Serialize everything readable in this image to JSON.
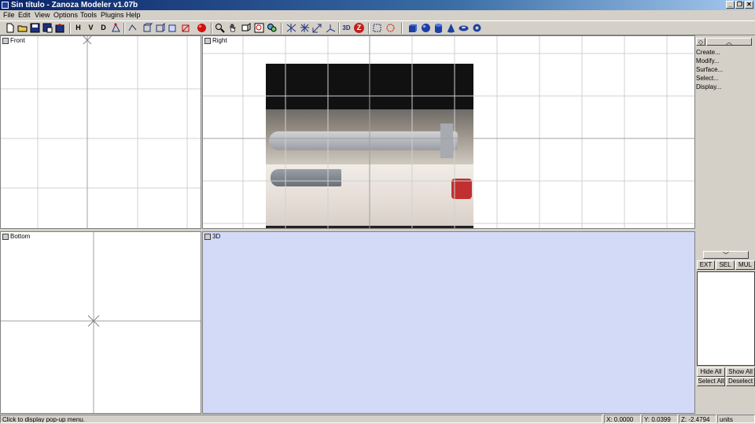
{
  "window": {
    "title": "Sin título - Zanoza Modeler v1.07b"
  },
  "window_buttons": {
    "minimize": "_",
    "restore": "❐",
    "close": "✕"
  },
  "menu": [
    "File",
    "Edit",
    "View",
    "Options",
    "Tools",
    "Plugins",
    "Help"
  ],
  "toolbar": {
    "group1": [
      "new-file-icon",
      "open-folder-icon",
      "save-icon",
      "save-as-icon",
      "export-icon"
    ],
    "view_buttons": [
      "H",
      "V",
      "D"
    ],
    "group2": [
      "select-vertex-icon",
      "select-edge-icon",
      "select-face-icon",
      "select-object-icon",
      "select-group-icon",
      "select-all-icon",
      "material-icon",
      "render-sphere-icon"
    ],
    "group3": [
      "zoom-icon",
      "pan-hand-icon",
      "rotate-view-icon",
      "zoom-extents-icon",
      "zoom-all-icon"
    ],
    "group4": [
      "move-icon",
      "rotate-icon",
      "scale-icon",
      "axis-icon"
    ],
    "group5_text": [
      "3D",
      "Z"
    ],
    "group6": [
      "rect-select-icon",
      "circle-select-icon"
    ],
    "primitives": [
      "box-primitive-icon",
      "sphere-primitive-icon",
      "cylinder-primitive-icon",
      "cone-primitive-icon",
      "torus-primitive-icon",
      "tube-primitive-icon"
    ],
    "colors": {
      "accent_blue": "#1c3fa3",
      "sphere_red": "#d41010"
    }
  },
  "viewports": {
    "front": {
      "label": "Front"
    },
    "right": {
      "label": "Right"
    },
    "bottom": {
      "label": "Bottom"
    },
    "view3d": {
      "label": "3D",
      "background": "#d2daf8"
    }
  },
  "panel": {
    "menu_items": [
      "Create...",
      "Modify...",
      "Surface...",
      "Select...",
      "Display..."
    ],
    "tabs": [
      "EXT",
      "SEL",
      "MUL"
    ],
    "actions": [
      "Hide All",
      "Show All",
      "Select All",
      "Deselect"
    ]
  },
  "status": {
    "message": "Click to display pop-up menu.",
    "x": "X: 0.0000",
    "y": "Y: 0.0399",
    "z": "Z: -2.4794",
    "units": "units"
  }
}
